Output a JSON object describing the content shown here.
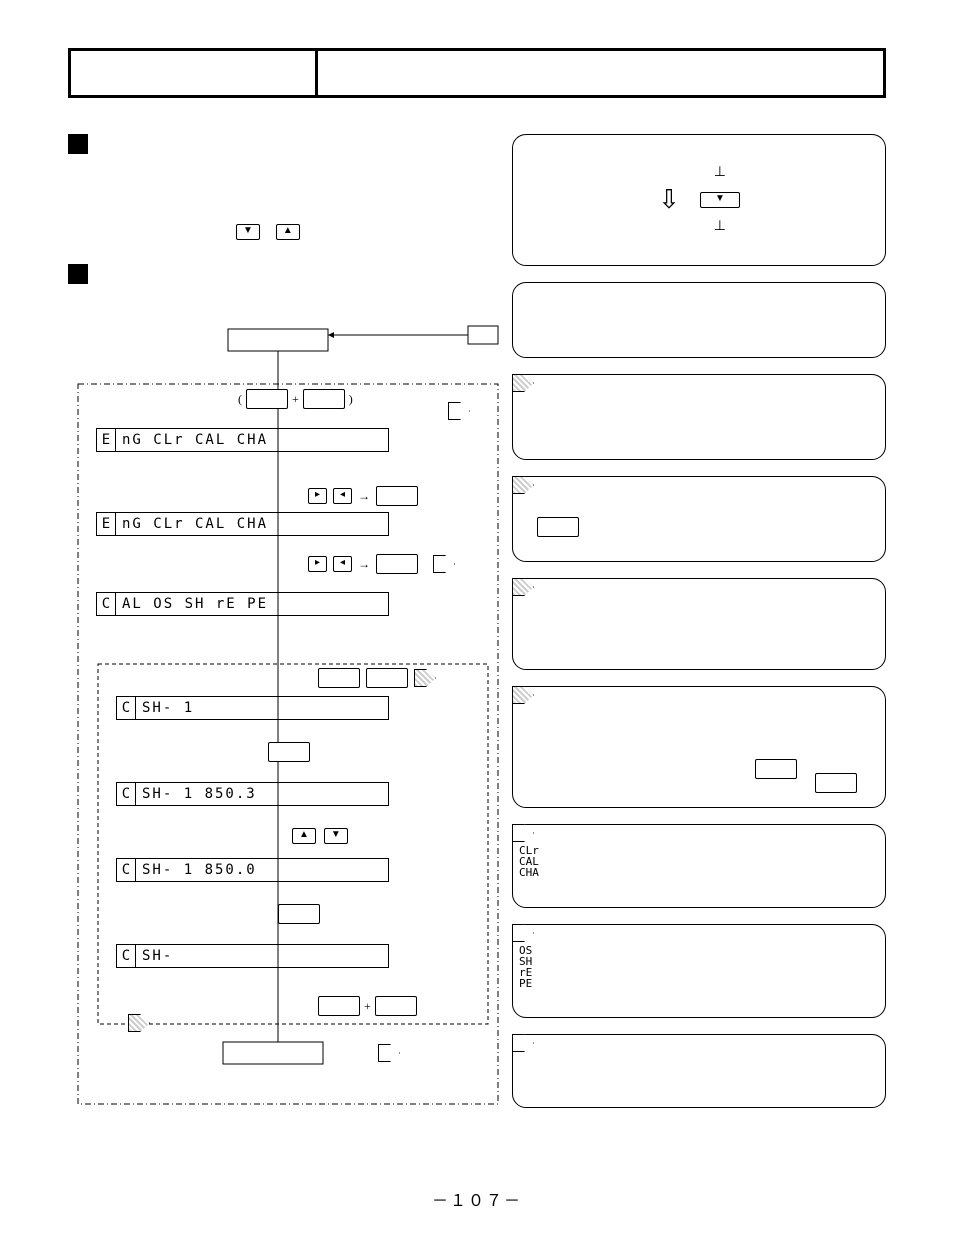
{
  "page_number": "－１０７－",
  "side_key_label": "▼",
  "mini_keys": {
    "down": "▼",
    "up": "▲",
    "right": "▸",
    "left": "◂"
  },
  "flow_box_top": " ",
  "lcd": {
    "l1_first": "E",
    "l1_rest": "nG   CLr  CAL  CHA",
    "l2_first": "E",
    "l2_rest": "nG   CLr  CAL  CHA",
    "l3_first": "C",
    "l3_rest": "AL   OS  SH  rE  PE",
    "l4_first": "C",
    "l4_rest": "SH-   1",
    "l5_first": "C",
    "l5_rest": "SH-  1 850.3",
    "l6_first": "C",
    "l6_rest": "SH-  1 850.0",
    "l7_first": "C",
    "l7_rest": "SH-"
  },
  "legend1": {
    "a": "CLr",
    "b": "CAL",
    "c": "CHA"
  },
  "legend2": {
    "a": "OS",
    "b": "SH",
    "c": "rE",
    "d": "PE"
  },
  "plus": "+",
  "arrow_right": "→"
}
